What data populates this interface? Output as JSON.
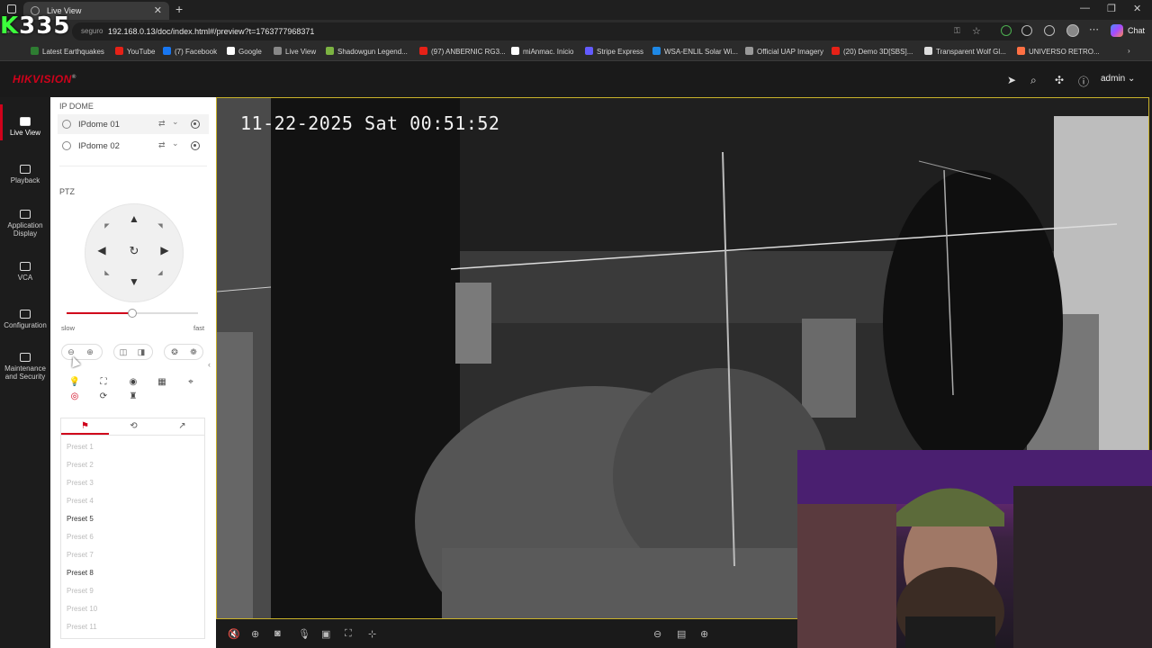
{
  "browser": {
    "tab_title": "Live View",
    "url_prefix": "seguro",
    "url": "192.168.0.13/doc/index.html#/preview?t=1763777968371",
    "chat_label": "Chat",
    "bookmarks": [
      {
        "label": "Latest Earthquakes",
        "color": "#2e7d32"
      },
      {
        "label": "YouTube",
        "color": "#e62117"
      },
      {
        "label": "(7) Facebook",
        "color": "#1877f2"
      },
      {
        "label": "Google",
        "color": "#ffffff"
      },
      {
        "label": "Live View",
        "color": "#888888"
      },
      {
        "label": "Shadowgun Legend...",
        "color": "#7cb342"
      },
      {
        "label": "(97) ANBERNIC RG3...",
        "color": "#e62117"
      },
      {
        "label": "miAnmac. Inicio",
        "color": "#ffffff"
      },
      {
        "label": "Stripe Express",
        "color": "#635bff"
      },
      {
        "label": "WSA-ENLIL Solar Wi...",
        "color": "#1e88e5"
      },
      {
        "label": "Official UAP Imagery",
        "color": "#999999"
      },
      {
        "label": "(20) Demo 3D[SBS]...",
        "color": "#e62117"
      },
      {
        "label": "Transparent Wolf Gl...",
        "color": "#dddddd"
      },
      {
        "label": "UNIVERSO RETRO...",
        "color": "#ff7043"
      }
    ]
  },
  "overlay_counter": {
    "prefix": "K",
    "value": "335"
  },
  "app": {
    "brand": "HIKVISION",
    "brand_mark": "®",
    "user": "admin",
    "nav": [
      {
        "label": "Live View",
        "active": true
      },
      {
        "label": "Playback"
      },
      {
        "label": "Application Display"
      },
      {
        "label": "VCA"
      },
      {
        "label": "Configuration"
      },
      {
        "label": "Maintenance and Security"
      }
    ]
  },
  "panel": {
    "device_section": "IP DOME",
    "cameras": [
      {
        "name": "IPdome 01",
        "selected": true
      },
      {
        "name": "IPdome 02"
      }
    ],
    "ptz_section": "PTZ",
    "speed": {
      "min_label": "slow",
      "max_label": "fast",
      "level": 0.5
    },
    "presets": [
      {
        "label": "Preset 1",
        "set": false
      },
      {
        "label": "Preset 2",
        "set": false
      },
      {
        "label": "Preset 3",
        "set": false
      },
      {
        "label": "Preset 4",
        "set": false
      },
      {
        "label": "Preset 5",
        "set": true
      },
      {
        "label": "Preset 6",
        "set": false
      },
      {
        "label": "Preset 7",
        "set": false
      },
      {
        "label": "Preset 8",
        "set": true
      },
      {
        "label": "Preset 9",
        "set": false
      },
      {
        "label": "Preset 10",
        "set": false
      },
      {
        "label": "Preset 11",
        "set": false
      }
    ]
  },
  "video": {
    "osd_timestamp": "11-22-2025 Sat 00:51:52"
  },
  "colors": {
    "accent": "#d0021b",
    "selection_border": "#c9b22a"
  }
}
